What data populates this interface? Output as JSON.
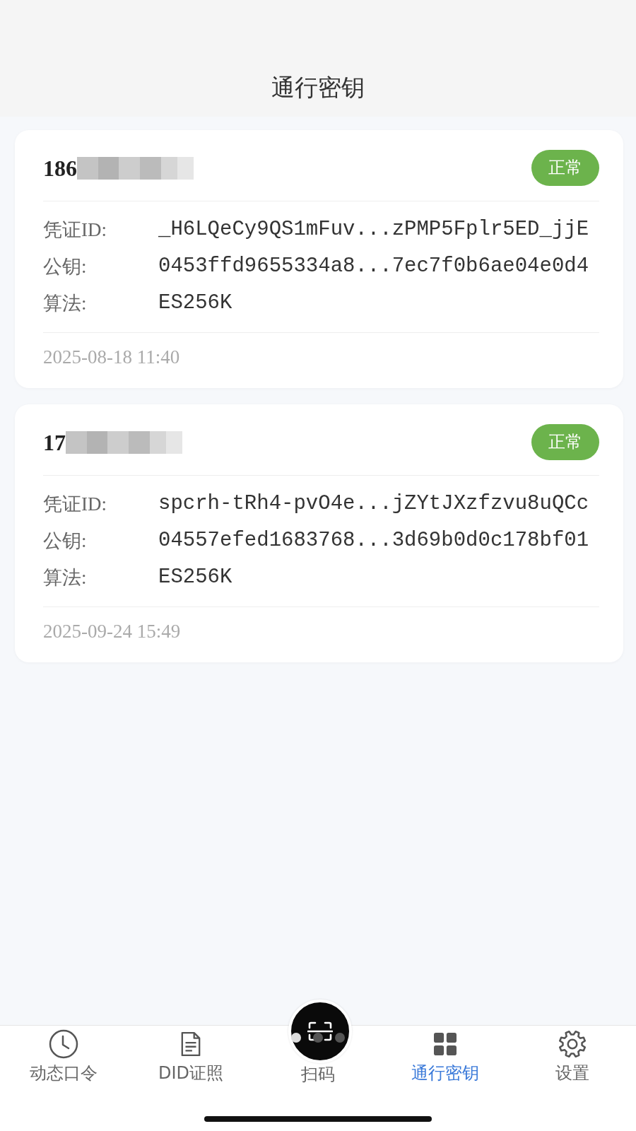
{
  "header": {
    "title": "通行密钥"
  },
  "keys": [
    {
      "title": "186",
      "status": {
        "label": "正常",
        "kind": "normal"
      },
      "fields": [
        {
          "label": "凭证ID:",
          "value": "_H6LQeCy9QS1mFuv...zPMP5Fplr5ED_jjE"
        },
        {
          "label": "公钥:",
          "value": "0453ffd9655334a8...7ec7f0b6ae04e0d4"
        },
        {
          "label": "算法:",
          "value": "ES256K"
        }
      ],
      "created": "2025-08-18 11:40"
    },
    {
      "title": "17",
      "status": {
        "label": "正常",
        "kind": "normal"
      },
      "fields": [
        {
          "label": "凭证ID:",
          "value": "spcrh-tRh4-pvO4e...jZYtJXzfzvu8uQCc"
        },
        {
          "label": "公钥:",
          "value": "04557efed1683768...3d69b0d0c178bf01"
        },
        {
          "label": "算法:",
          "value": "ES256K"
        }
      ],
      "created": "2025-09-24 15:49"
    }
  ],
  "tab_bar": {
    "items": [
      {
        "label": "动态口令",
        "kind": "tab",
        "selected": false
      },
      {
        "label": "DID证照",
        "kind": "tab",
        "selected": false
      },
      {
        "label": "扫码",
        "kind": "scan",
        "selected": false
      },
      {
        "label": "通行密钥",
        "kind": "tab",
        "selected": true
      },
      {
        "label": "设置",
        "kind": "tab",
        "selected": false
      }
    ]
  },
  "page_dots": [
    {
      "selected": true
    },
    {
      "selected": false
    },
    {
      "selected": false
    }
  ]
}
